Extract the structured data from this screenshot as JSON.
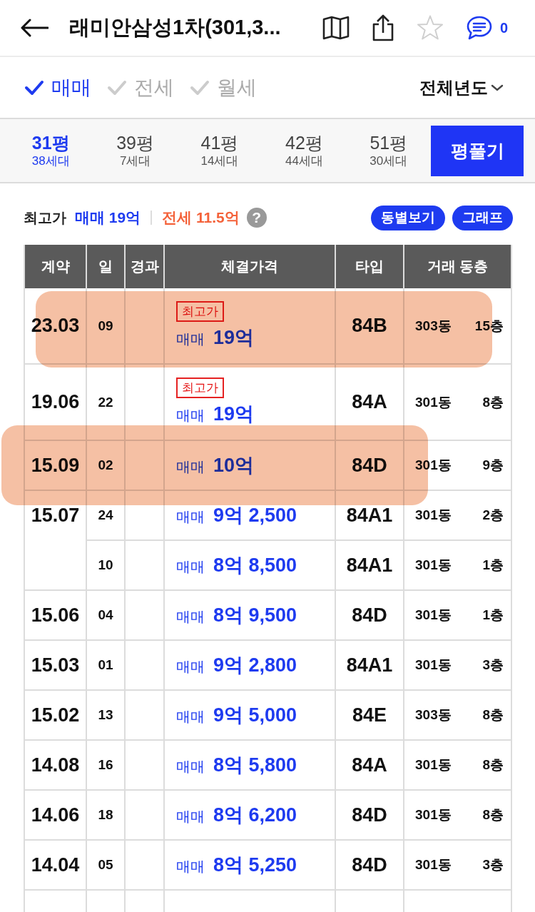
{
  "header": {
    "title": "래미안삼성1차(301,3...",
    "favorite": false,
    "comment_count": "0"
  },
  "deal_filters": [
    {
      "label": "매매",
      "checked": true
    },
    {
      "label": "전세",
      "checked": false
    },
    {
      "label": "월세",
      "checked": false
    }
  ],
  "year_filter": "전체년도",
  "size_tabs": [
    {
      "size": "31평",
      "households": "38세대",
      "selected": true
    },
    {
      "size": "39평",
      "households": "7세대",
      "selected": false
    },
    {
      "size": "41평",
      "households": "14세대",
      "selected": false
    },
    {
      "size": "42평",
      "households": "44세대",
      "selected": false
    },
    {
      "size": "51평",
      "households": "30세대",
      "selected": false
    }
  ],
  "size_button": "평풀기",
  "summary": {
    "label": "최고가",
    "sale": "매매 19억",
    "jeonse": "전세 11.5억",
    "help": "?",
    "buttons": [
      "동별보기",
      "그래프"
    ]
  },
  "table": {
    "columns": [
      "계약",
      "일",
      "경과",
      "체결가격",
      "타입",
      "거래 동층"
    ],
    "rows": [
      {
        "month": "23.03",
        "highlighted": true,
        "deals": [
          {
            "day": "09",
            "tag": "최고가",
            "trade": "매매",
            "price": "19억",
            "unit_type": "84B",
            "building": "303동",
            "floor": "15층"
          }
        ]
      },
      {
        "month": "19.06",
        "highlighted": false,
        "deals": [
          {
            "day": "22",
            "tag": "최고가",
            "trade": "매매",
            "price": "19억",
            "unit_type": "84A",
            "building": "301동",
            "floor": "8층"
          }
        ]
      },
      {
        "month": "15.09",
        "highlighted": true,
        "deals": [
          {
            "day": "02",
            "trade": "매매",
            "price": "10억",
            "unit_type": "84D",
            "building": "301동",
            "floor": "9층"
          }
        ]
      },
      {
        "month": "15.07",
        "highlighted": false,
        "deals": [
          {
            "day": "24",
            "trade": "매매",
            "price": "9억 2,500",
            "unit_type": "84A1",
            "building": "301동",
            "floor": "2층"
          },
          {
            "day": "10",
            "trade": "매매",
            "price": "8억 8,500",
            "unit_type": "84A1",
            "building": "301동",
            "floor": "1층"
          }
        ]
      },
      {
        "month": "15.06",
        "highlighted": false,
        "deals": [
          {
            "day": "04",
            "trade": "매매",
            "price": "8억 9,500",
            "unit_type": "84D",
            "building": "301동",
            "floor": "1층"
          }
        ]
      },
      {
        "month": "15.03",
        "highlighted": false,
        "deals": [
          {
            "day": "01",
            "trade": "매매",
            "price": "9억 2,800",
            "unit_type": "84A1",
            "building": "301동",
            "floor": "3층"
          }
        ]
      },
      {
        "month": "15.02",
        "highlighted": false,
        "deals": [
          {
            "day": "13",
            "trade": "매매",
            "price": "9억 5,000",
            "unit_type": "84E",
            "building": "303동",
            "floor": "8층"
          }
        ]
      },
      {
        "month": "14.08",
        "highlighted": false,
        "deals": [
          {
            "day": "16",
            "trade": "매매",
            "price": "8억 5,800",
            "unit_type": "84A",
            "building": "301동",
            "floor": "8층"
          }
        ]
      },
      {
        "month": "14.06",
        "highlighted": false,
        "deals": [
          {
            "day": "18",
            "trade": "매매",
            "price": "8억 6,200",
            "unit_type": "84D",
            "building": "301동",
            "floor": "8층"
          }
        ]
      },
      {
        "month": "14.04",
        "highlighted": false,
        "deals": [
          {
            "day": "05",
            "trade": "매매",
            "price": "8억 5,250",
            "unit_type": "84D",
            "building": "301동",
            "floor": "3층"
          }
        ]
      }
    ]
  }
}
